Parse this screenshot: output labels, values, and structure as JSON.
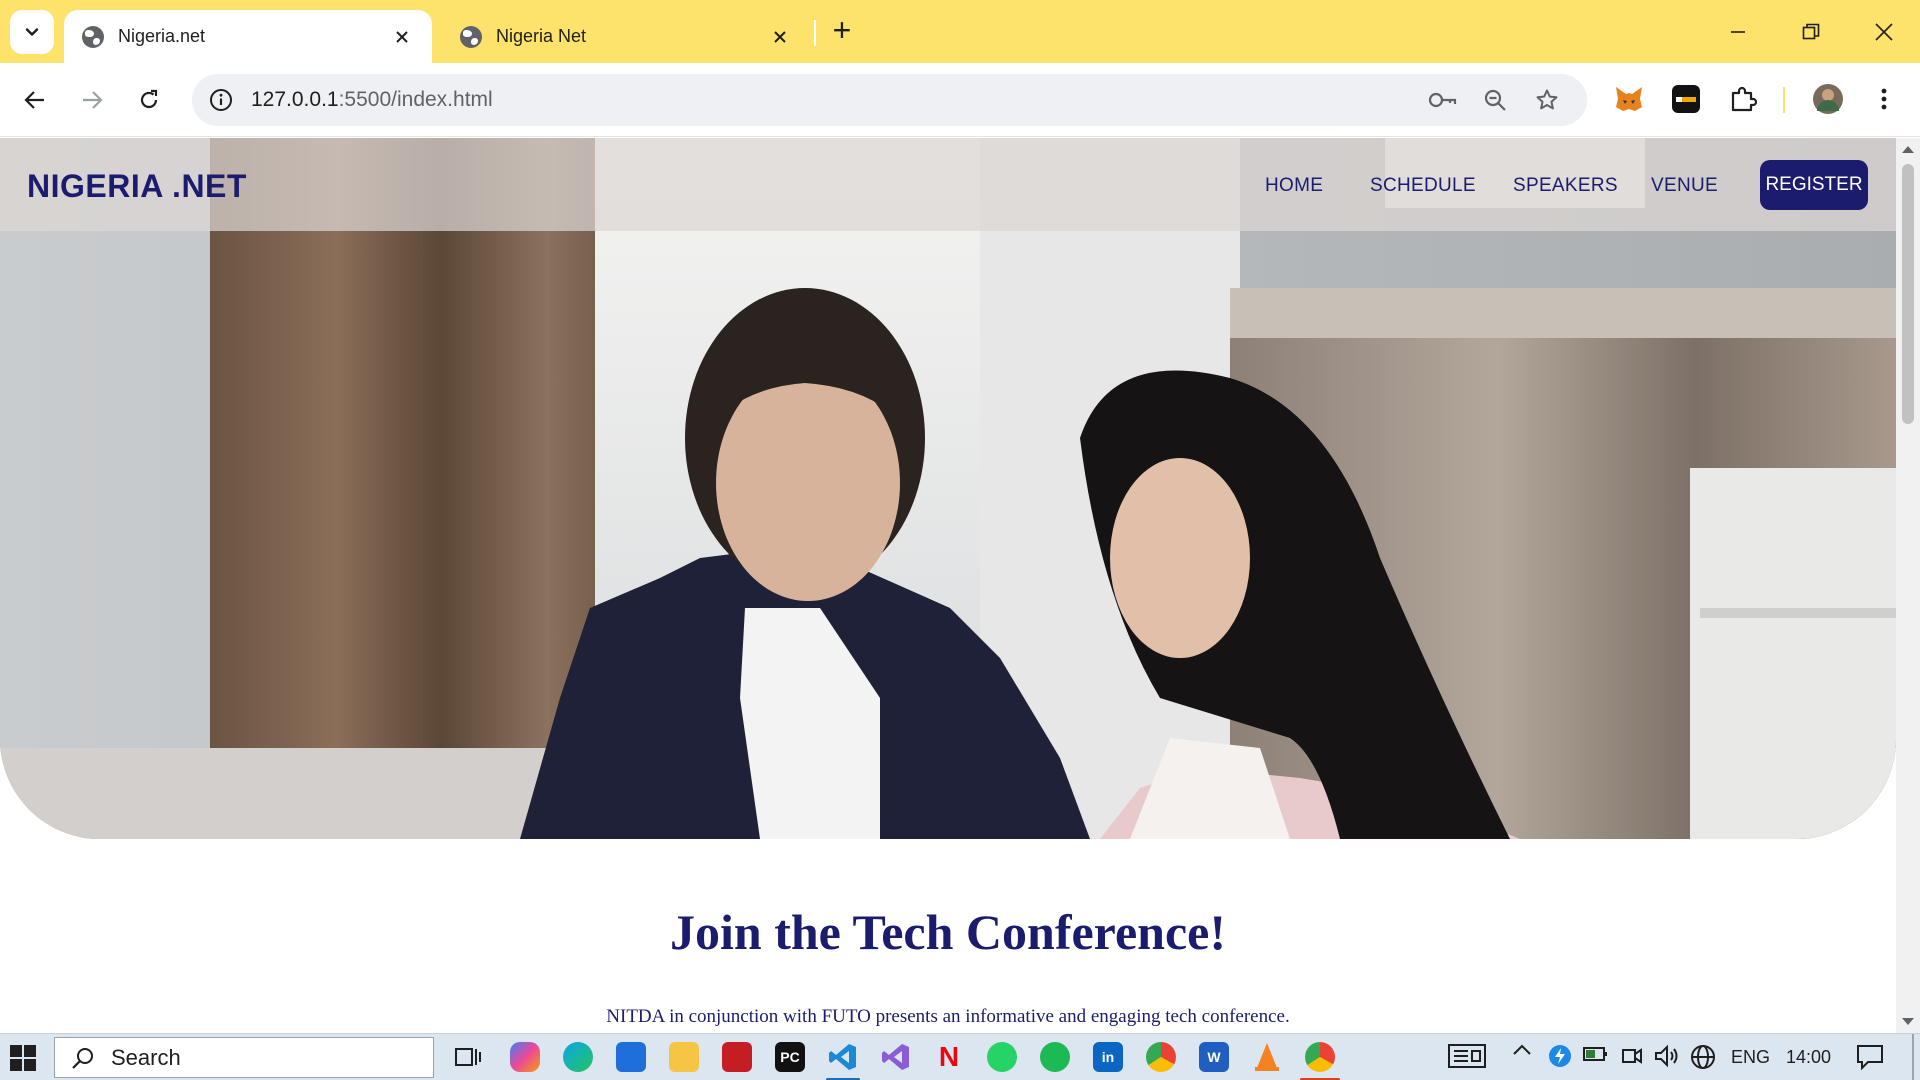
{
  "browser": {
    "tabs": [
      {
        "title": "Nigeria.net",
        "active": true
      },
      {
        "title": "Nigeria Net",
        "active": false
      }
    ],
    "new_tab_label": "+",
    "url_host": "127.0.0.1",
    "url_rest": ":5500/index.html"
  },
  "site": {
    "logo": "NIGERIA .NET",
    "nav": [
      "HOME",
      "SCHEDULE",
      "SPEAKERS",
      "VENUE"
    ],
    "register_label": "REGISTER",
    "heading": "Join the Tech Conference!",
    "subtext": "NITDA in conjunction with FUTO presents an informative and engaging tech conference."
  },
  "taskbar": {
    "search_label": "Search",
    "language": "ENG",
    "time": "14:00",
    "apps": [
      "copilot-icon",
      "edge-icon",
      "store-icon",
      "file-explorer-icon",
      "app-red-icon",
      "pycharm-icon",
      "vscode-icon",
      "visual-studio-icon",
      "netflix-icon",
      "whatsapp-icon",
      "spotify-icon",
      "linkedin-icon",
      "chrome-icon",
      "word-icon",
      "vlc-icon",
      "chrome-active-icon"
    ]
  },
  "colors": {
    "tabstrip": "#fde26b",
    "brand_navy": "#1c1c6e",
    "taskbar": "#dce6f0"
  }
}
